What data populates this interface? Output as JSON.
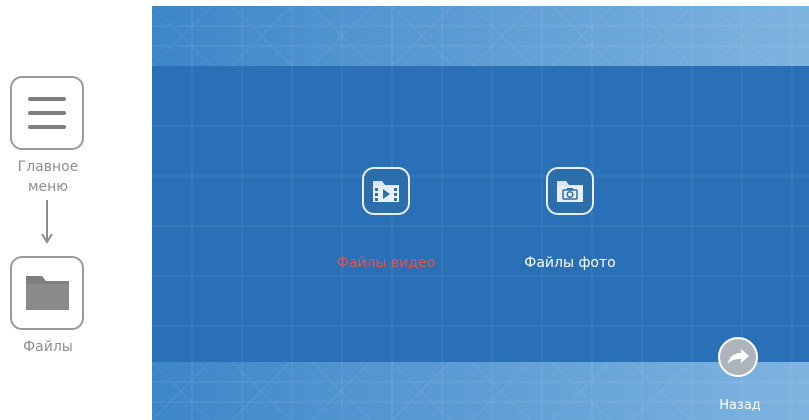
{
  "guide": {
    "menu_label": "Главное меню",
    "files_label": "Файлы",
    "menu_icon": "menu-icon",
    "files_icon": "folder-icon",
    "arrow_icon": "arrow-down-icon"
  },
  "screen": {
    "video_label": "Файлы видео",
    "photo_label": "Файлы фото",
    "back_label": "Назад",
    "video_icon": "video-folder-icon",
    "photo_icon": "photo-folder-icon",
    "back_icon": "forward-arrow-icon",
    "colors": {
      "accent_red": "#e4504f",
      "main_blue": "#2a70b6",
      "band_blue": "#5b9bd2"
    }
  }
}
